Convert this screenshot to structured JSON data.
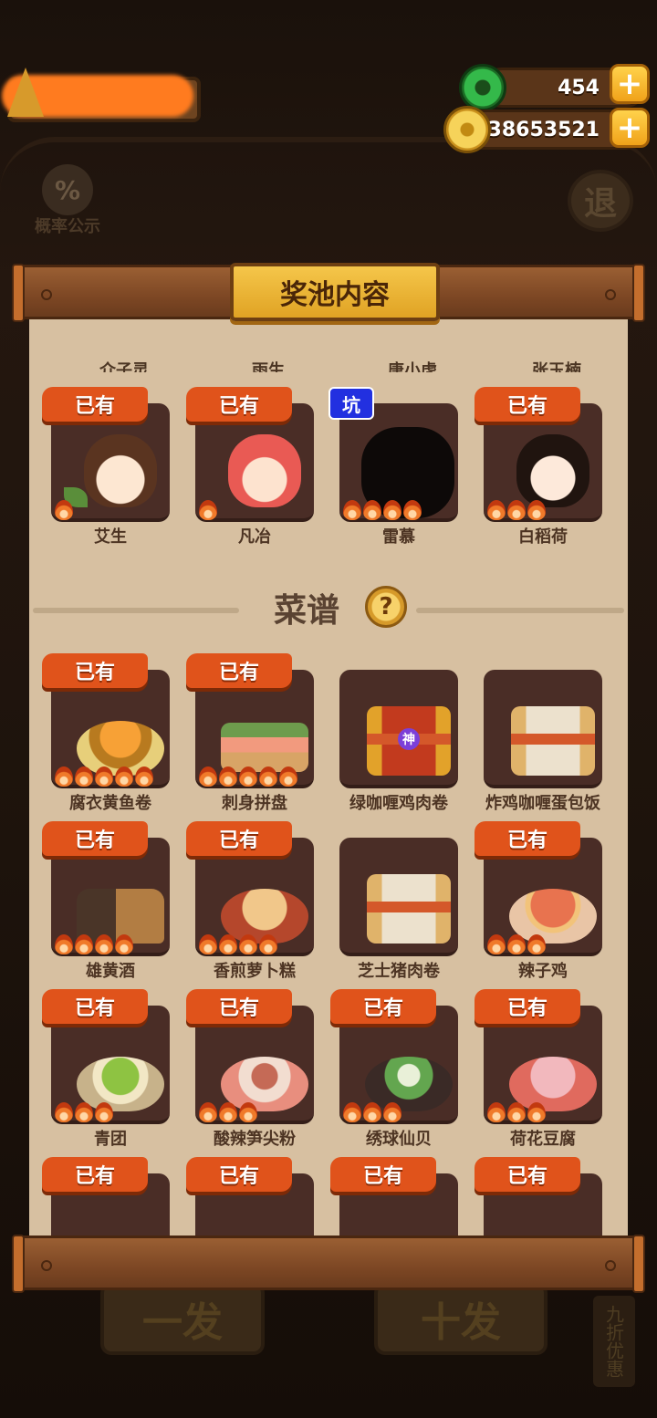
{
  "hud": {
    "jade": "454",
    "coins": "38653521",
    "plus": "+",
    "prob_icon": "%",
    "prob_label": "概率公示",
    "exit_label": "退",
    "draw_one": "一发",
    "draw_ten": "十发",
    "discount": "九折优惠"
  },
  "modal": {
    "title": "奖池内容",
    "cut_names": [
      "介子灵",
      "雨生",
      "唐小虎",
      "张玉楠"
    ],
    "characters": [
      {
        "badge": "已有",
        "name": "艾生",
        "flames": 1,
        "art": "brown"
      },
      {
        "badge": "已有",
        "name": "凡冶",
        "flames": 1,
        "art": "red"
      },
      {
        "badge": "坑",
        "name": "雷慕",
        "flames": 4,
        "art": "black"
      },
      {
        "badge": "已有",
        "name": "白稻荷",
        "flames": 3,
        "art": "bun"
      }
    ],
    "recipe_section": "菜谱",
    "help_icon": "?",
    "recipes": [
      {
        "badge": "已有",
        "name": "腐衣黄鱼卷",
        "flames": 5,
        "art": "dish gold"
      },
      {
        "badge": "已有",
        "name": "刺身拼盘",
        "flames": 5,
        "art": "dish sushi"
      },
      {
        "badge": "",
        "name": "绿咖喱鸡肉卷",
        "flames": 0,
        "art": "scroll-gold",
        "seal": "神"
      },
      {
        "badge": "",
        "name": "炸鸡咖喱蛋包饭",
        "flames": 0,
        "art": "scroll-plain"
      },
      {
        "badge": "已有",
        "name": "雄黄酒",
        "flames": 4,
        "art": "dish jar"
      },
      {
        "badge": "已有",
        "name": "香煎萝卜糕",
        "flames": 4,
        "art": "dish roast"
      },
      {
        "badge": "",
        "name": "芝士猪肉卷",
        "flames": 0,
        "art": "scroll-plain"
      },
      {
        "badge": "已有",
        "name": "辣子鸡",
        "flames": 3,
        "art": "dish noodle"
      },
      {
        "badge": "已有",
        "name": "青团",
        "flames": 3,
        "art": "dish green"
      },
      {
        "badge": "已有",
        "name": "酸辣笋尖粉",
        "flames": 3,
        "art": "dish pink"
      },
      {
        "badge": "已有",
        "name": "绣球仙贝",
        "flames": 3,
        "art": "dish bowl-green"
      },
      {
        "badge": "已有",
        "name": "荷花豆腐",
        "flames": 3,
        "art": "dish tofu"
      },
      {
        "badge": "已有",
        "name": "",
        "flames": 0,
        "art": "none"
      },
      {
        "badge": "已有",
        "name": "",
        "flames": 0,
        "art": "none"
      },
      {
        "badge": "已有",
        "name": "",
        "flames": 0,
        "art": "none"
      },
      {
        "badge": "已有",
        "name": "",
        "flames": 0,
        "art": "none"
      }
    ]
  }
}
